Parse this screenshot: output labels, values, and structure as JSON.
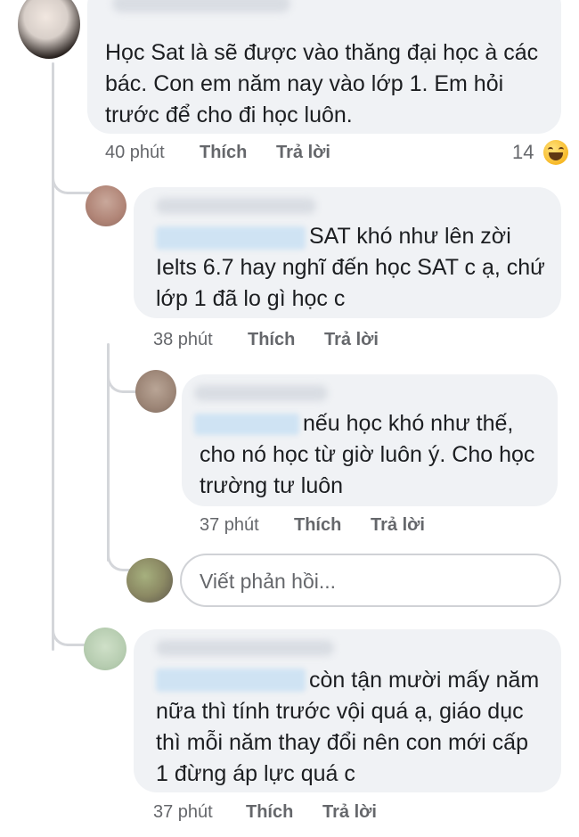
{
  "comments": [
    {
      "text_lines": [
        "Học Sat là sẽ được vào thăng đại học à các",
        "bác. Con em năm nay vào lớp 1. Em hỏi",
        "trước để cho đi học luôn."
      ],
      "time": "40 phút",
      "like_label": "Thích",
      "reply_label": "Trả lời",
      "reaction_count": "14",
      "reaction_icon": "laughing-emoji"
    },
    {
      "text_lines": [
        "SAT khó như lên zời",
        "Ielts 6.7 hay nghĩ đến học SAT c ạ, chứ",
        "lớp 1 đã lo gì học c"
      ],
      "time": "38 phút",
      "like_label": "Thích",
      "reply_label": "Trả lời"
    },
    {
      "text_lines": [
        "nếu học khó như thế,",
        "cho nó học từ giờ luôn ý. Cho học",
        "trường tư luôn"
      ],
      "time": "37 phút",
      "like_label": "Thích",
      "reply_label": "Trả lời"
    },
    {
      "text_lines": [
        "còn tận mười mấy năm",
        "nữa thì tính trước vội quá ạ, giáo dục",
        "thì mỗi năm thay đổi nên con mới cấp",
        "1 đừng áp lực quá c"
      ],
      "time": "37 phút",
      "like_label": "Thích",
      "reply_label": "Trả lời"
    }
  ],
  "reply_box": {
    "placeholder": "Viết phản hồi..."
  },
  "colors": {
    "bubble_bg": "#f0f2f5",
    "meta_text": "#65676b",
    "thread_line": "#d4d6da"
  }
}
